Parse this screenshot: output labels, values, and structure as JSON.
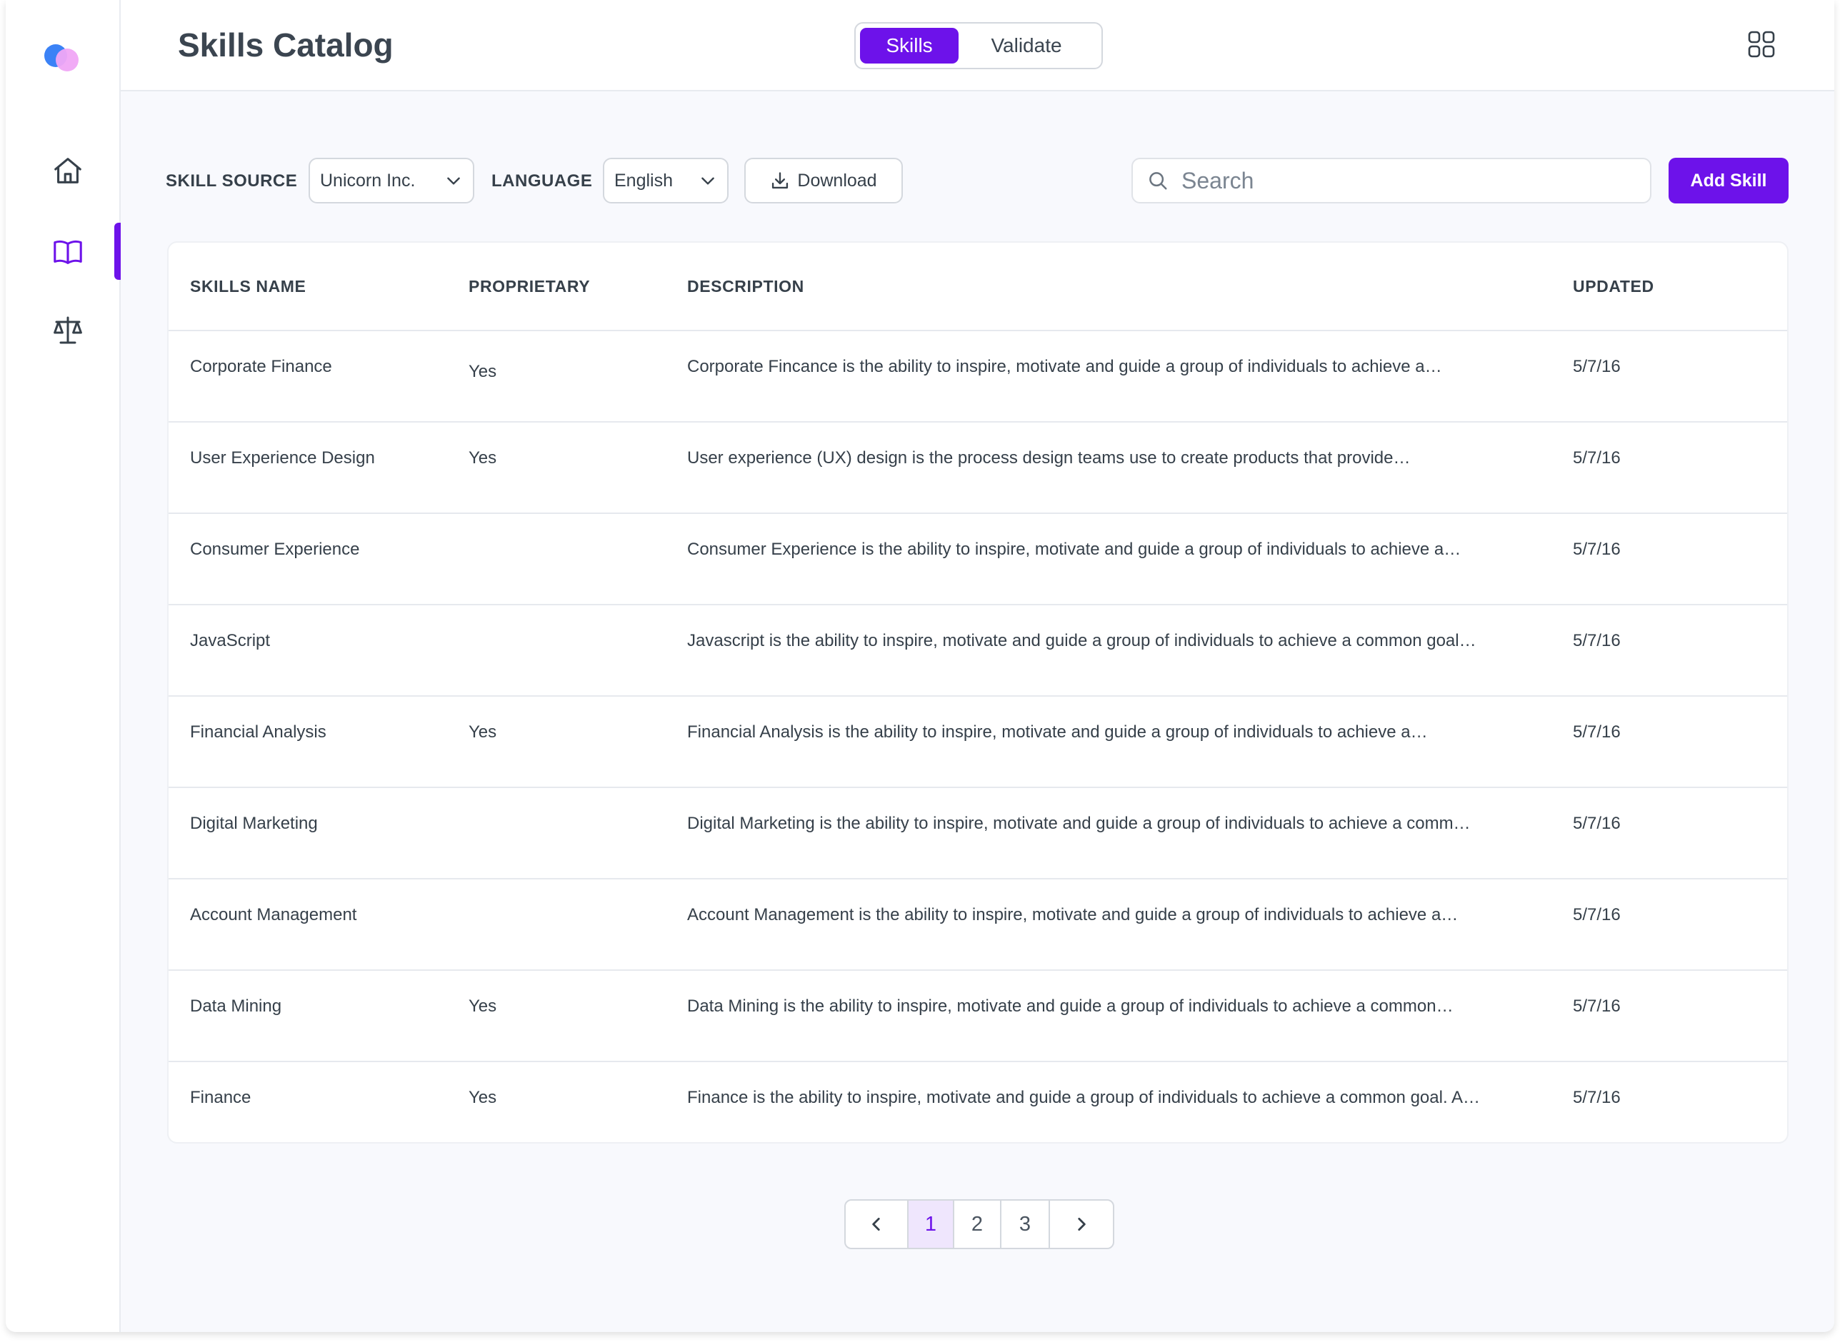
{
  "header": {
    "title": "Skills Catalog",
    "tabs": [
      {
        "label": "Skills",
        "active": true
      },
      {
        "label": "Validate",
        "active": false
      }
    ],
    "apps_icon": "grid-icon"
  },
  "sidebar": {
    "logo": "app-logo",
    "items": [
      {
        "icon": "home-icon",
        "active": false
      },
      {
        "icon": "book-icon",
        "active": true
      },
      {
        "icon": "scale-icon",
        "active": false
      }
    ]
  },
  "toolbar": {
    "skill_source_label": "SKILL SOURCE",
    "skill_source_value": "Unicorn Inc.",
    "language_label": "LANGUAGE",
    "language_value": "English",
    "download_label": "Download",
    "search_placeholder": "Search",
    "add_label": "Add Skill"
  },
  "table": {
    "columns": [
      "SKILLS NAME",
      "PROPRIETARY",
      "DESCRIPTION",
      "UPDATED"
    ],
    "rows": [
      {
        "name": "Corporate Finance",
        "proprietary": "Yes",
        "description": "Corporate Fincance is the ability to inspire, motivate and guide a group of individuals to achieve a…",
        "updated": "5/7/16"
      },
      {
        "name": "User Experience Design",
        "proprietary": "Yes",
        "description": "User experience (UX) design is the process design teams use to create products that provide…",
        "updated": "5/7/16"
      },
      {
        "name": "Consumer Experience",
        "proprietary": "",
        "description": "Consumer Experience is the ability to inspire, motivate and guide a group of individuals to achieve a…",
        "updated": "5/7/16"
      },
      {
        "name": "JavaScript",
        "proprietary": "",
        "description": "Javascript is the ability to inspire, motivate and guide a group of individuals to achieve a common goal…",
        "updated": "5/7/16"
      },
      {
        "name": "Financial Analysis",
        "proprietary": "Yes",
        "description": "Financial Analysis is the ability to inspire, motivate and guide a group of individuals to achieve a…",
        "updated": "5/7/16"
      },
      {
        "name": "Digital Marketing",
        "proprietary": "",
        "description": "Digital Marketing is the ability to inspire, motivate and guide a group of individuals to achieve a comm…",
        "updated": "5/7/16"
      },
      {
        "name": "Account Management",
        "proprietary": "",
        "description": "Account Management is the ability to inspire, motivate and guide a group of individuals to achieve a…",
        "updated": "5/7/16"
      },
      {
        "name": "Data Mining",
        "proprietary": "Yes",
        "description": "Data Mining is the ability to inspire, motivate and guide a group of individuals to achieve a common…",
        "updated": "5/7/16"
      },
      {
        "name": "Finance",
        "proprietary": "Yes",
        "description": "Finance is the ability to inspire, motivate and guide a group of individuals to achieve a common goal. A…",
        "updated": "5/7/16"
      }
    ]
  },
  "pagination": {
    "prev_icon": "chevron-left-icon",
    "pages": [
      "1",
      "2",
      "3"
    ],
    "current": "1",
    "next_icon": "chevron-right-icon"
  },
  "colors": {
    "accent": "#6d12ea",
    "text": "#36404a",
    "background": "#f8f9fd"
  }
}
